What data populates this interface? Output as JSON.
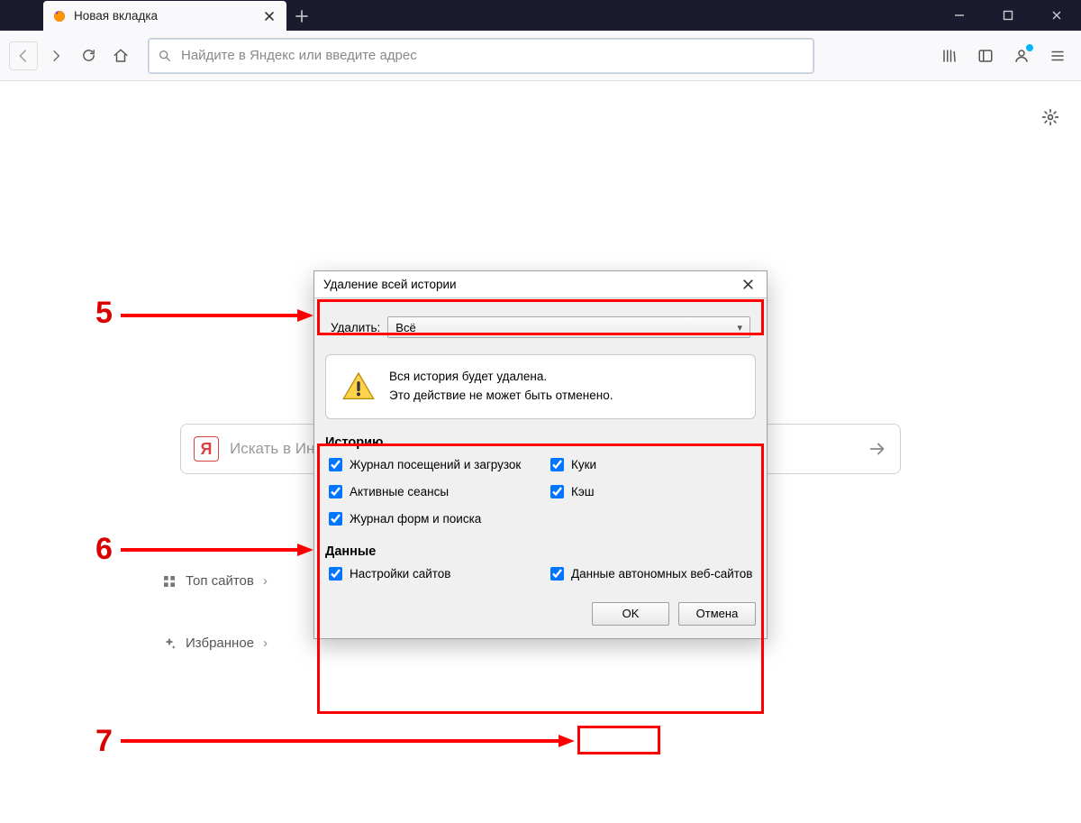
{
  "tab": {
    "title": "Новая вкладка"
  },
  "urlbar": {
    "placeholder": "Найдите в Яндекс или введите адрес"
  },
  "yandex_search": {
    "placeholder": "Искать в Инте",
    "logo_letter": "Я"
  },
  "home_links": {
    "top_sites": "Топ сайтов",
    "favorites": "Избранное"
  },
  "dialog": {
    "title": "Удаление всей истории",
    "delete_label": "Удалить:",
    "delete_value": "Всё",
    "warning_line1": "Вся история будет удалена.",
    "warning_line2": "Это действие не может быть отменено.",
    "group_history": "Историю",
    "group_data": "Данные",
    "checks": {
      "browsing": "Журнал посещений и загрузок",
      "cookies": "Куки",
      "sessions": "Активные сеансы",
      "cache": "Кэш",
      "forms": "Журнал форм и поиска",
      "site_settings": "Настройки сайтов",
      "offline": "Данные автономных веб-сайтов"
    },
    "ok": "OK",
    "cancel": "Отмена"
  },
  "annotations": {
    "n5": "5",
    "n6": "6",
    "n7": "7"
  }
}
